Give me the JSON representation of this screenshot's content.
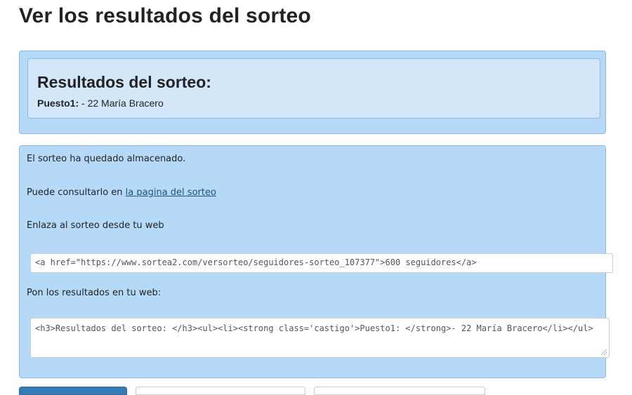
{
  "page": {
    "title": "Ver los resultados del sorteo"
  },
  "results": {
    "heading": "Resultados del sorteo:",
    "position_label": "Puesto1:",
    "position_value": " - 22 María Bracero"
  },
  "info": {
    "stored_message": "El sorteo ha quedado almacenado.",
    "consult_prefix": "Puede consultarlo en ",
    "consult_link": "la pagina del sorteo",
    "link_label": "Enlaza al sorteo desde tu web",
    "link_code": "<a href=\"https://www.sortea2.com/versorteo/seguidores-sorteo_107377\">600 seguidores</a>",
    "embed_label": "Pon los resultados en tu web:",
    "embed_code": "<h3>Resultados del sorteo: </h3><ul><li><strong class='castigo'>Puesto1: </strong>- 22 María Bracero</li></ul>"
  },
  "colors": {
    "panel_bg": "#b7d9f8",
    "inner_panel_bg": "#d3e7fb",
    "panel_border": "#8bb8e8",
    "link": "#1d4f82",
    "primary_button": "#337ab7"
  }
}
